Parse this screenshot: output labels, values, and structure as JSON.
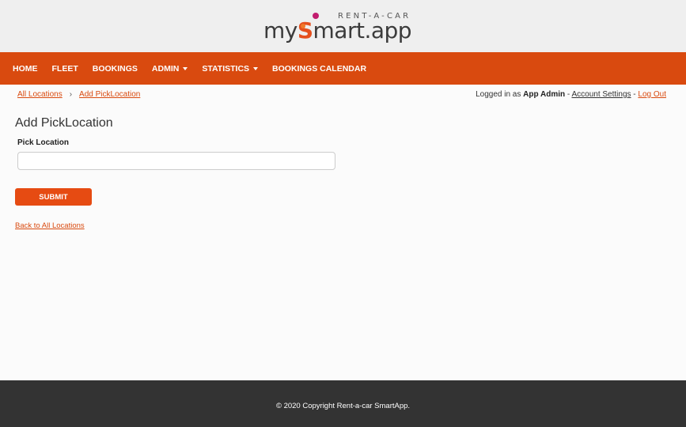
{
  "logo": {
    "tagline": "RENT-A-CAR",
    "brand_prefix": "my",
    "brand_s": "S",
    "brand_suffix": "mart.app"
  },
  "nav": {
    "items": [
      {
        "label": "HOME"
      },
      {
        "label": "FLEET"
      },
      {
        "label": "BOOKINGS"
      },
      {
        "label": "ADMIN"
      },
      {
        "label": "STATISTICS"
      },
      {
        "label": "BOOKINGS CALENDAR"
      }
    ]
  },
  "breadcrumb": {
    "items": [
      "All Locations",
      "Add PickLocation"
    ],
    "separator": "›"
  },
  "user": {
    "prefix": "Logged in as ",
    "name": "App Admin",
    "sep1": " - ",
    "account_settings": "Account Settings",
    "sep2": " - ",
    "logout": "Log Out"
  },
  "form": {
    "title": "Add PickLocation",
    "field_label": "Pick Location",
    "field_value": "",
    "submit_label": "SUBMIT",
    "back_link": "Back to All Locations"
  },
  "footer": {
    "text": "© 2020 Copyright Rent-a-car SmartApp."
  },
  "colors": {
    "brand": "#d94a0f",
    "button": "#e64b12",
    "footer_bg": "#333333",
    "header_bg": "#efefef"
  }
}
